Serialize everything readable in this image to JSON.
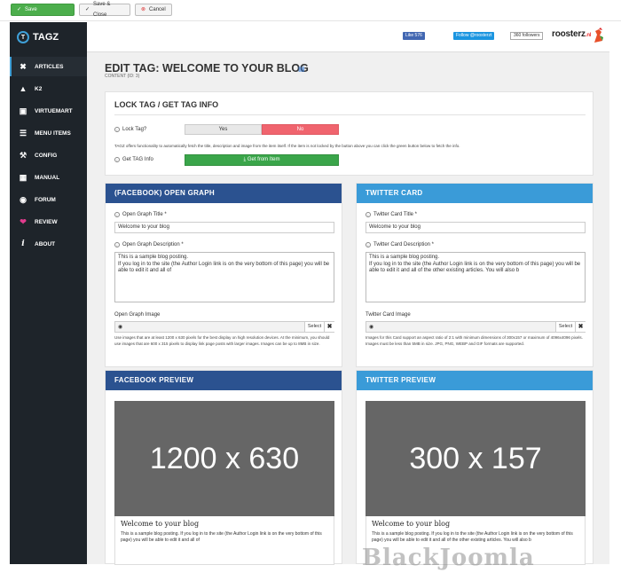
{
  "toolbar": {
    "save_label": "Save",
    "save_close_label": "Save & Close",
    "cancel_label": "Cancel",
    "save_icon": "check-icon",
    "cancel_icon": "close-circle-icon"
  },
  "sidebar": {
    "logo_text": "TAGZ",
    "items": [
      {
        "label": "ARTICLES",
        "icon": "joomla-icon"
      },
      {
        "label": "K2",
        "icon": "k2-icon"
      },
      {
        "label": "VIRTUEMART",
        "icon": "cart-icon"
      },
      {
        "label": "MENU ITEMS",
        "icon": "menu-icon"
      },
      {
        "label": "CONFIG",
        "icon": "wrench-icon"
      },
      {
        "label": "MANUAL",
        "icon": "document-icon"
      },
      {
        "label": "FORUM",
        "icon": "chat-icon"
      },
      {
        "label": "REVIEW",
        "icon": "heart-icon"
      },
      {
        "label": "ABOUT",
        "icon": "info-icon"
      }
    ]
  },
  "topbar": {
    "fb_like": "Like 576",
    "tw_follow": "Follow @roosterzt",
    "tw_followers": "360 followers",
    "brand": "roosterz",
    "brand_suffix": ".nl"
  },
  "page": {
    "title": "EDIT TAG: WELCOME TO YOUR BLOG",
    "subtitle": "CONTENT (ID: 3)"
  },
  "lock": {
    "title": "LOCK TAG / GET TAG INFO",
    "lock_label": "Lock Tag?",
    "yes": "Yes",
    "no": "No",
    "description": "TAGZ offers functionality to automatically fetch the title, description and image from the item itself. If the item is not locked by the button above you can click the green button below to fetch the info.",
    "get_label": "Get TAG Info",
    "fetch_button": "Get from Item"
  },
  "og": {
    "header": "(FACEBOOK) OPEN GRAPH",
    "title_label": "Open Graph Title *",
    "title_value": "Welcome to your blog",
    "desc_label": "Open Graph Description *",
    "desc_value": "This is a sample blog posting.\nIf you log in to the site (the Author Login link is on the very bottom of this page) you will be able to edit it and all of",
    "image_label": "Open Graph Image",
    "select_label": "Select",
    "help": "Use images that are at least 1200 x 630 pixels for the best display on high resolution devices. At the minimum, you should use images that are 600 x 315 pixels to display link page posts with larger images. Images can be up to 8MB in size."
  },
  "tc": {
    "header": "TWITTER CARD",
    "title_label": "Twitter Card Title *",
    "title_value": "Welcome to your blog",
    "desc_label": "Twitter Card Description *",
    "desc_value": "This is a sample blog posting.\nIf you log in to the site (the Author Login link is on the very bottom of this page) you will be able to edit it and all of the other existing articles. You will also b",
    "image_label": "Twitter Card Image",
    "select_label": "Select",
    "help": "Images for this Card support an aspect ratio of 2:1 with minimum dimensions of 300x157 or maximum of 4096x4096 pixels. Images must be less than 5MB in size. JPG, PNG, WEBP and GIF formats are supported."
  },
  "fb_preview": {
    "header": "FACEBOOK PREVIEW",
    "placeholder": "1200 x 630",
    "title": "Welcome to your blog",
    "desc": "This is a sample blog posting. If you log in to the site (the Author Login link is on the very bottom of this page) you will be able to edit it and all of"
  },
  "tw_preview": {
    "header": "TWITTER PREVIEW",
    "placeholder": "300 x 157",
    "title": "Welcome to your blog",
    "desc": "This is a sample blog posting. If you log in to the site (the Author Login link is on the very bottom of this page) you will be able to edit it and all of the other existing articles. You will also b"
  },
  "watermark": "BlackJoomla",
  "colors": {
    "sidebar_bg": "#1e242a",
    "og_blue": "#2b5290",
    "twitter_blue": "#3a9bd8",
    "save_green": "#4cae4c",
    "no_red": "#f0646e"
  }
}
